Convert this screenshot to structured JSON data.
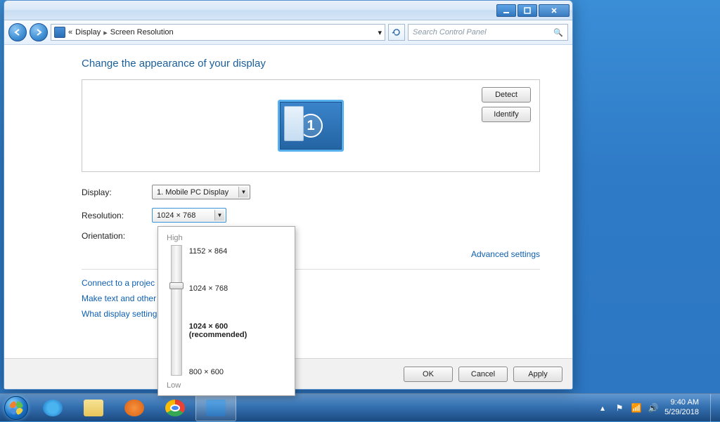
{
  "breadcrumb": {
    "prefix": "«",
    "part1": "Display",
    "part2": "Screen Resolution"
  },
  "search": {
    "placeholder": "Search Control Panel"
  },
  "heading": "Change the appearance of your display",
  "monitor": {
    "number": "1"
  },
  "buttons": {
    "detect": "Detect",
    "identify": "Identify",
    "ok": "OK",
    "cancel": "Cancel",
    "apply": "Apply"
  },
  "labels": {
    "display": "Display:",
    "resolution": "Resolution:",
    "orientation": "Orientation:"
  },
  "combos": {
    "display": "1. Mobile PC Display",
    "resolution": "1024 × 768"
  },
  "links": {
    "advanced": "Advanced settings",
    "projector": "Connect to a projec",
    "textsize": "Make text and other",
    "what": "What display setting"
  },
  "slider": {
    "high": "High",
    "low": "Low",
    "ticks": [
      "1152 × 864",
      "1024 × 768",
      "1024 × 600 (recommended)",
      "800 × 600"
    ]
  },
  "tray": {
    "time": "9:40 AM",
    "date": "5/29/2018"
  }
}
